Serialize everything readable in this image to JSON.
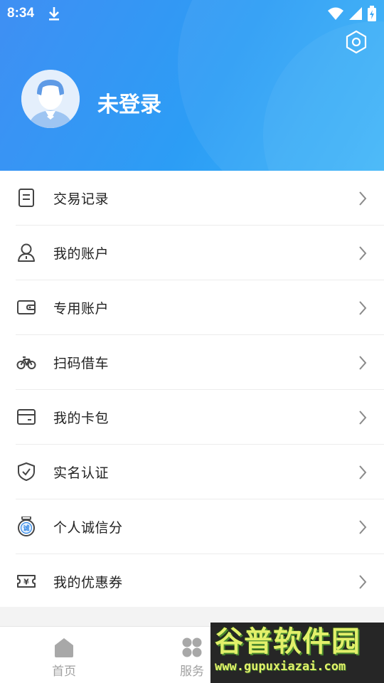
{
  "status_bar": {
    "time": "8:34"
  },
  "profile": {
    "username": "未登录"
  },
  "menu": {
    "items": [
      {
        "label": "交易记录",
        "icon": "receipt-icon"
      },
      {
        "label": "我的账户",
        "icon": "user-icon"
      },
      {
        "label": "专用账户",
        "icon": "wallet-icon"
      },
      {
        "label": "扫码借车",
        "icon": "bike-icon"
      },
      {
        "label": "我的卡包",
        "icon": "card-icon"
      },
      {
        "label": "实名认证",
        "icon": "shield-check-icon"
      },
      {
        "label": "个人诚信分",
        "icon": "credit-badge-icon",
        "badge_text": "诚"
      },
      {
        "label": "我的优惠券",
        "icon": "coupon-icon",
        "badge_text": "¥"
      }
    ]
  },
  "bottom_nav": {
    "items": [
      {
        "label": "首页",
        "icon": "home-icon"
      },
      {
        "label": "服务",
        "icon": "services-icon"
      }
    ]
  },
  "watermark": {
    "title": "谷普软件园",
    "url": "www.gupuxiazai.com"
  },
  "colors": {
    "header_gradient_start": "#3f8ff3",
    "header_gradient_end": "#3ab4f8",
    "menu_text": "#222222",
    "nav_text": "#a0a0a0",
    "icon_stroke": "#444444",
    "credit_accent": "#2f86e6"
  }
}
